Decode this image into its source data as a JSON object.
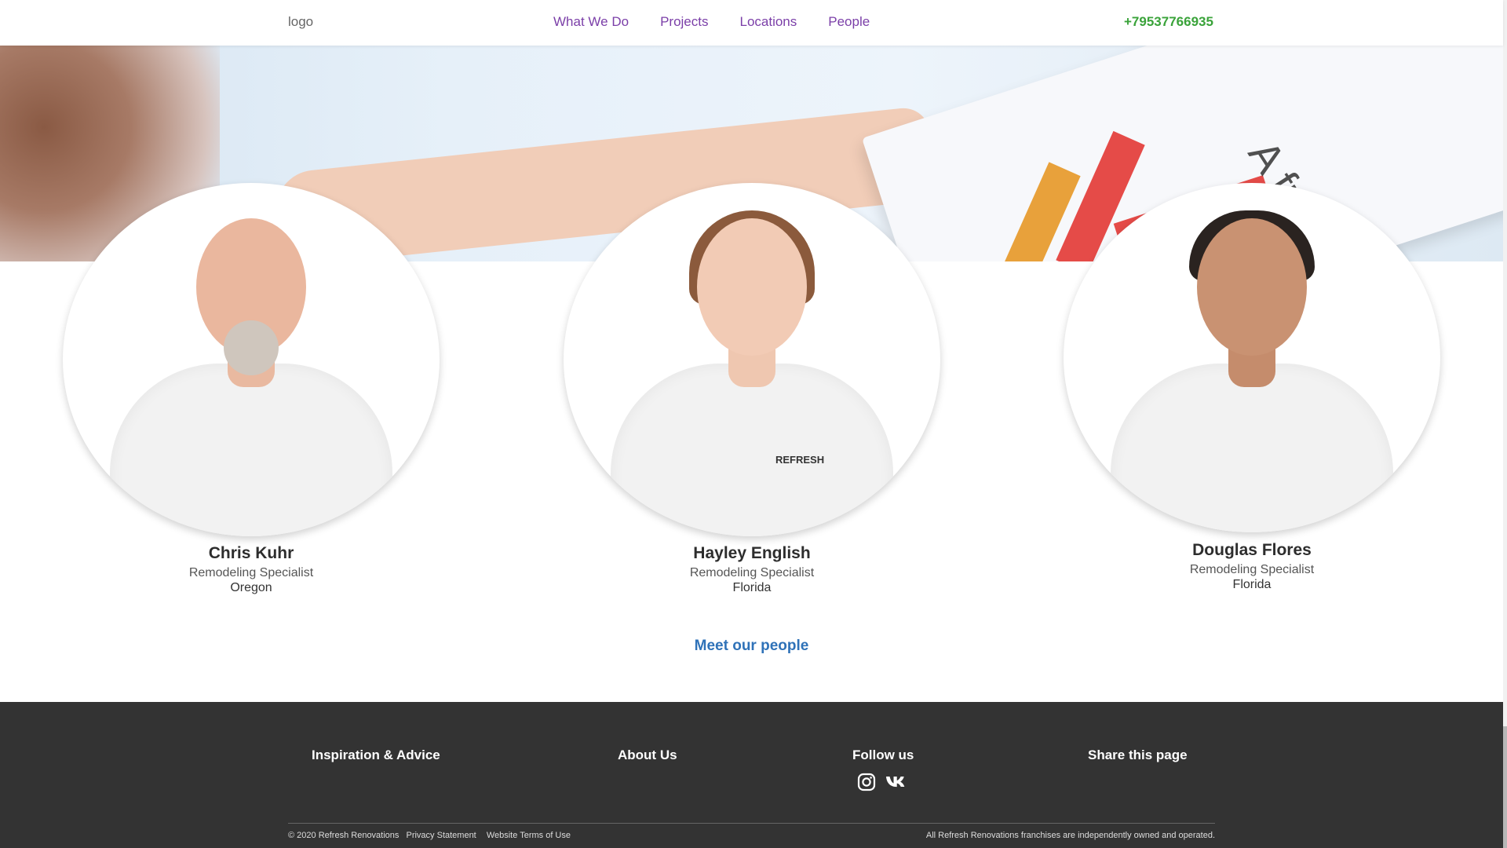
{
  "header": {
    "logo_text": "logo",
    "nav": [
      "What We Do",
      "Projects",
      "Locations",
      "People"
    ],
    "phone": "+79537766935"
  },
  "hero": {
    "card_text": "A fresh a"
  },
  "people": [
    {
      "name": "Chris Kuhr",
      "role": "Remodeling Specialist",
      "location": "Oregon"
    },
    {
      "name": "Hayley English",
      "role": "Remodeling Specialist",
      "location": "Florida",
      "shirt_logo": "REFRESH"
    },
    {
      "name": "Douglas Flores",
      "role": "Remodeling Specialist",
      "location": "Florida"
    }
  ],
  "meet_link": "Meet our people",
  "footer": {
    "columns": [
      "Inspiration & Advice",
      "About Us",
      "Follow us",
      "Share this page"
    ],
    "social_icons": [
      "instagram-icon",
      "vk-icon"
    ],
    "copyright": "© 2020 Refresh Renovations",
    "privacy": "Privacy Statement",
    "terms": "Website Terms of Use",
    "disclaimer": "All Refresh Renovations franchises are independently owned and operated."
  },
  "colors": {
    "nav": "#7b3fa8",
    "phone": "#3aa33a",
    "link": "#2f72b8",
    "footer_bg": "#333333"
  }
}
